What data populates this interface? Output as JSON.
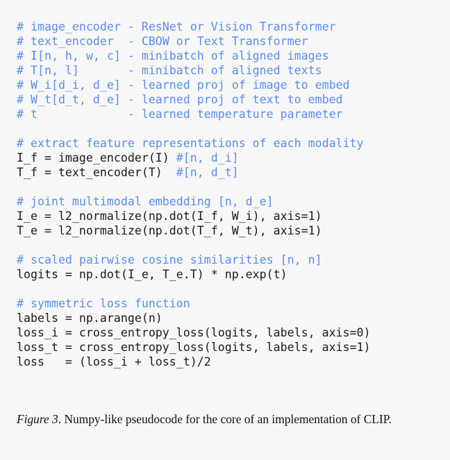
{
  "figure": {
    "background_color": "#f7f7f7",
    "comment_color": "#5b8df0",
    "code_color": "#1a1a1a",
    "caption": {
      "label": "Figure 3",
      "label_suffix": ". ",
      "text": "Numpy-like pseudocode for the core of an implementation of CLIP.",
      "full": "Figure 3. Numpy-like pseudocode for the core of an implementation of CLIP."
    },
    "code": {
      "language": "python-pseudocode",
      "lines": [
        {
          "kind": "comment",
          "text": "# image_encoder - ResNet or Vision Transformer"
        },
        {
          "kind": "comment",
          "text": "# text_encoder  - CBOW or Text Transformer"
        },
        {
          "kind": "comment",
          "text": "# I[n, h, w, c] - minibatch of aligned images"
        },
        {
          "kind": "comment",
          "text": "# T[n, l]       - minibatch of aligned texts"
        },
        {
          "kind": "comment",
          "text": "# W_i[d_i, d_e] - learned proj of image to embed"
        },
        {
          "kind": "comment",
          "text": "# W_t[d_t, d_e] - learned proj of text to embed"
        },
        {
          "kind": "comment",
          "text": "# t             - learned temperature parameter"
        },
        {
          "kind": "blank",
          "text": ""
        },
        {
          "kind": "comment",
          "text": "# extract feature representations of each modality"
        },
        {
          "kind": "mixed",
          "code": "I_f = image_encoder(I) ",
          "comment": "#[n, d_i]"
        },
        {
          "kind": "mixed",
          "code": "T_f = text_encoder(T)  ",
          "comment": "#[n, d_t]"
        },
        {
          "kind": "blank",
          "text": ""
        },
        {
          "kind": "comment",
          "text": "# joint multimodal embedding [n, d_e]"
        },
        {
          "kind": "code",
          "text": "I_e = l2_normalize(np.dot(I_f, W_i), axis=1)"
        },
        {
          "kind": "code",
          "text": "T_e = l2_normalize(np.dot(T_f, W_t), axis=1)"
        },
        {
          "kind": "blank",
          "text": ""
        },
        {
          "kind": "comment",
          "text": "# scaled pairwise cosine similarities [n, n]"
        },
        {
          "kind": "code",
          "text": "logits = np.dot(I_e, T_e.T) * np.exp(t)"
        },
        {
          "kind": "blank",
          "text": ""
        },
        {
          "kind": "comment",
          "text": "# symmetric loss function"
        },
        {
          "kind": "code",
          "text": "labels = np.arange(n)"
        },
        {
          "kind": "code",
          "text": "loss_i = cross_entropy_loss(logits, labels, axis=0)"
        },
        {
          "kind": "code",
          "text": "loss_t = cross_entropy_loss(logits, labels, axis=1)"
        },
        {
          "kind": "code",
          "text": "loss   = (loss_i + loss_t)/2"
        }
      ]
    }
  }
}
